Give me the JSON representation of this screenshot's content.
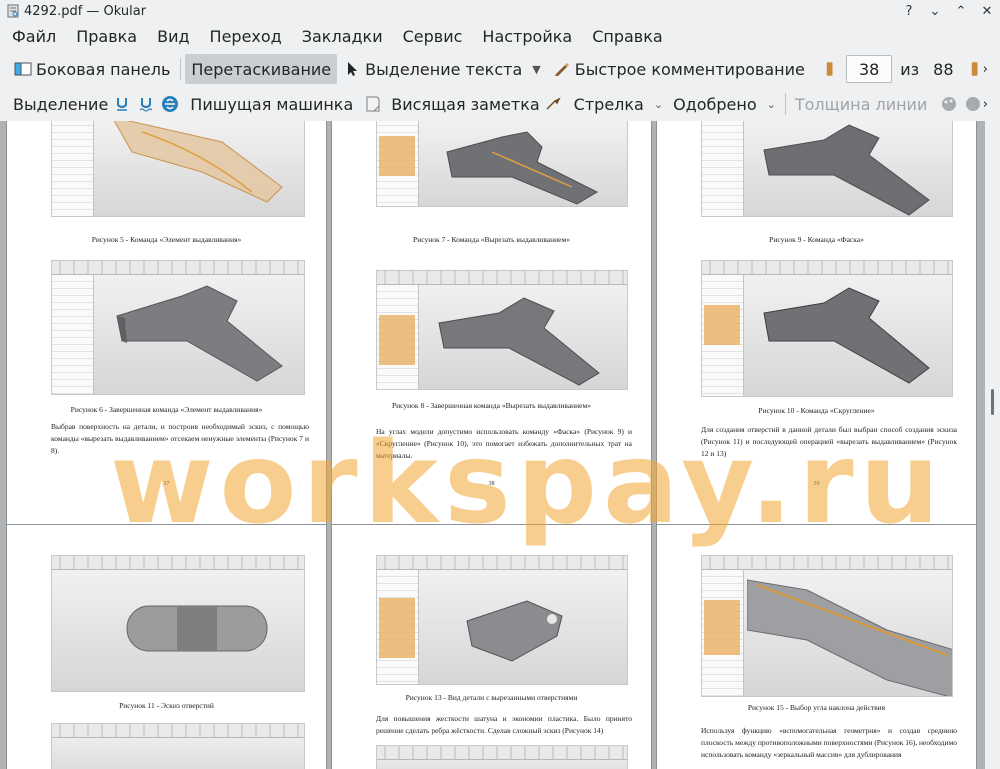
{
  "window": {
    "title": "4292.pdf — Okular",
    "controls": {
      "help": "?",
      "minimize": "⌄",
      "maximize": "⌃",
      "close": "✕"
    }
  },
  "menubar": {
    "items": [
      "Файл",
      "Правка",
      "Вид",
      "Переход",
      "Закладки",
      "Сервис",
      "Настройка",
      "Справка"
    ]
  },
  "toolbar": {
    "sidebar_label": "Боковая панель",
    "browse_label": "Перетаскивание",
    "text_select_label": "Выделение текста",
    "quick_comment_label": "Быстрое комментирование",
    "page_current": "38",
    "page_of": "из",
    "page_total": "88"
  },
  "annotation_toolbar": {
    "highlight_label": "Выделение",
    "typewriter_label": "Пишущая машинка",
    "popup_note_label": "Висящая заметка",
    "arrow_label": "Стрелка",
    "stamp_label": "Одобрено",
    "line_width_label": "Толщина линии"
  },
  "document": {
    "watermark": "workspay.ru",
    "pages": [
      {
        "caption_top": "Рисунок 5 - Команда «Элемент выдавливания»",
        "caption_bottom": "Рисунок 6 - Завершенная команда «Элемент выдавливания»",
        "text": "Выбрав поверхность на детали, и построив необходимый эскиз, с помощью команды «вырезать выдавливанием» отсекаем ненужные элементы (Рисунок 7 и 8).",
        "number": "37"
      },
      {
        "caption_top": "Рисунок 7 - Команда «Вырезать выдавливанием»",
        "caption_bottom": "Рисунок 8 - Завершенная команда «Вырезать выдавливанием»",
        "text": "На углах модели допустимо использовать команду «Фаска» (Рисунок 9) и «Скругление» (Рисунок 10), это помогает избежать дополнительных трат на материалы.",
        "number": "38"
      },
      {
        "caption_top": "Рисунок 9 - Команда «Фаска»",
        "caption_bottom": "Рисунок 10 - Команда «Скругление»",
        "text": "Для создания отверстий в данной детали был выбран способ создания эскиза (Рисунок 11) и последующей операцией «вырезать выдавливанием» (Рисунок 12 и 13)",
        "number": "39"
      },
      {
        "caption_top": "Рисунок 11 - Эскиз отверстий"
      },
      {
        "caption_top": "Рисунок 13 - Вид детали с вырезанными отверстиями",
        "text": "Для повышения жесткости шатуна и экономии пластика. Было принято решение сделать ребра жёсткости. Сделав сложный эскиз (Рисунок 14)"
      },
      {
        "caption_top": "Рисунок 15 - Выбор угла наклона действия",
        "text": "Используя функцию «вспомогательная геометрия» и создав среднюю плоскость между противоположными поверхностями (Рисунок 16), необходимо использовать команду «зеркальный массив» для дублирования"
      }
    ]
  }
}
